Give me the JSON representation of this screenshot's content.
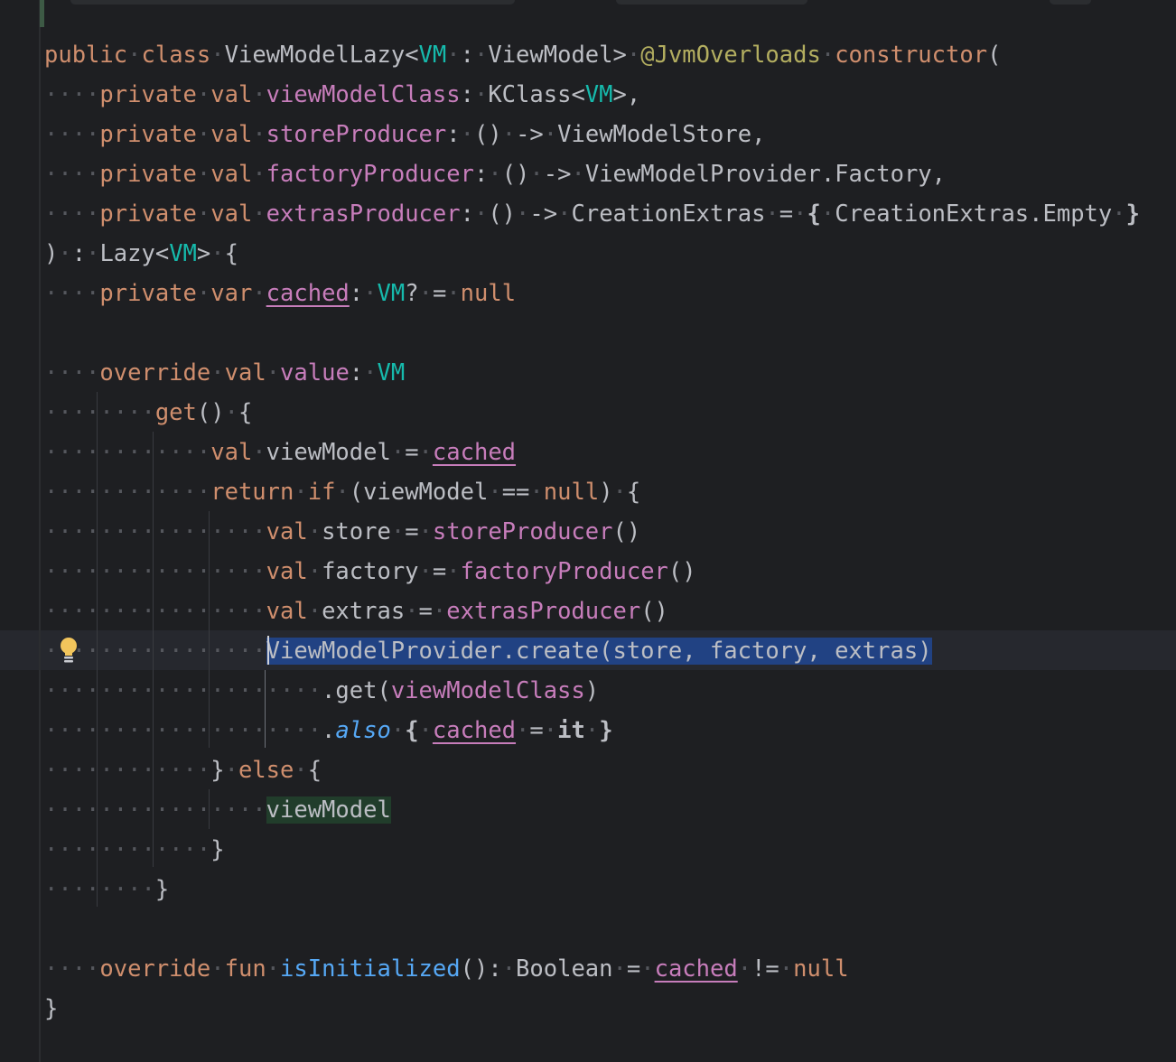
{
  "editor": {
    "language": "Kotlin",
    "theme": "dark",
    "colors": {
      "background": "#1e1f22",
      "default_text": "#bcbec4",
      "keyword": "#cf8e6d",
      "property": "#c77dbb",
      "type_parameter": "#16baac",
      "annotation": "#b3ae60",
      "function_declaration": "#56a8f5",
      "selection": "#214283",
      "identifier_highlight": "#213d2b",
      "current_line": "#26282e"
    },
    "gutter_icons": [
      "lightbulb-icon"
    ],
    "selected_text": "ViewModelProvider.create(store, factory, extras)",
    "highlighted_text": "viewModel",
    "lines": [
      {
        "dots": "",
        "text": "public class ViewModelLazy<VM : ViewModel> @JvmOverloads constructor("
      },
      {
        "dots": "····",
        "text": "private val viewModelClass: KClass<VM>,"
      },
      {
        "dots": "····",
        "text": "private val storeProducer: () -> ViewModelStore,"
      },
      {
        "dots": "····",
        "text": "private val factoryProducer: () -> ViewModelProvider.Factory,"
      },
      {
        "dots": "····",
        "text": "private val extrasProducer: () -> CreationExtras = { CreationExtras.Empty }"
      },
      {
        "dots": "",
        "text": ") : Lazy<VM> {"
      },
      {
        "dots": "····",
        "text": "private var cached: VM? = null"
      },
      {
        "dots": "",
        "text": ""
      },
      {
        "dots": "····",
        "text": "override val value: VM"
      },
      {
        "dots": "········",
        "text": "get() {"
      },
      {
        "dots": "············",
        "text": "val viewModel = cached"
      },
      {
        "dots": "············",
        "text": "return if (viewModel == null) {"
      },
      {
        "dots": "················",
        "text": "val store = storeProducer()"
      },
      {
        "dots": "················",
        "text": "val factory = factoryProducer()"
      },
      {
        "dots": "················",
        "text": "val extras = extrasProducer()"
      },
      {
        "dots": "················",
        "text": "ViewModelProvider.create(store, factory, extras)"
      },
      {
        "dots": "····················",
        "text": ".get(viewModelClass)"
      },
      {
        "dots": "····················",
        "text": ".also { cached = it }"
      },
      {
        "dots": "············",
        "text": "} else {"
      },
      {
        "dots": "················",
        "text": "viewModel"
      },
      {
        "dots": "············",
        "text": "}"
      },
      {
        "dots": "········",
        "text": "}"
      },
      {
        "dots": "",
        "text": ""
      },
      {
        "dots": "····",
        "text": "override fun isInitialized(): Boolean = cached != null"
      },
      {
        "dots": "",
        "text": "}"
      }
    ]
  }
}
